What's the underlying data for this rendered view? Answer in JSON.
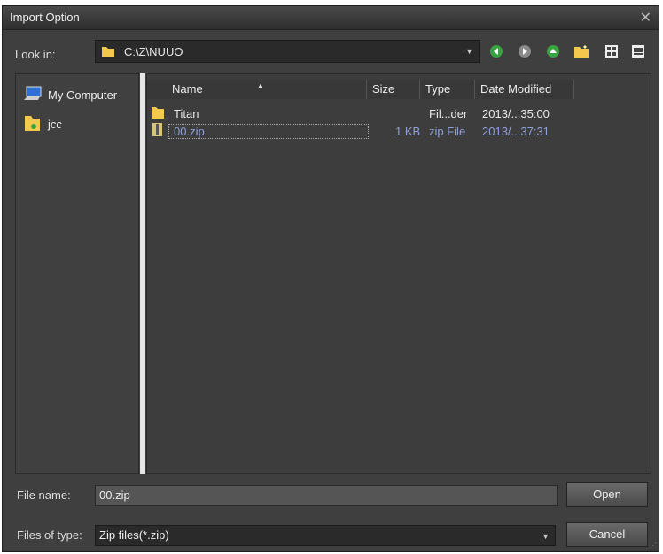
{
  "window": {
    "title": "Import Option",
    "close_glyph": "✕"
  },
  "look_in": {
    "label": "Look in:",
    "path": "C:\\Z\\NUUO"
  },
  "toolbar": {
    "icons": [
      "back-icon",
      "forward-icon",
      "up-icon",
      "new-folder-icon",
      "list-view-icon",
      "detail-view-icon"
    ]
  },
  "sidebar": {
    "items": [
      {
        "label": "My Computer",
        "icon": "computer-icon"
      },
      {
        "label": "jcc",
        "icon": "user-folder-icon"
      }
    ]
  },
  "filelist": {
    "columns": [
      "Name",
      "Size",
      "Type",
      "Date Modified"
    ],
    "rows": [
      {
        "name": "Titan",
        "size": "",
        "type": "Fil...der",
        "date": "2013/...35:00",
        "icon": "folder-icon",
        "selected": false
      },
      {
        "name": "00.zip",
        "size": "1 KB",
        "type": "zip File",
        "date": "2013/...37:31",
        "icon": "zip-file-icon",
        "selected": true
      }
    ]
  },
  "file_name": {
    "label": "File name:",
    "value": "00.zip"
  },
  "files_of_type": {
    "label": "Files of type:",
    "value": "Zip files(*.zip)"
  },
  "buttons": {
    "open": "Open",
    "cancel": "Cancel"
  },
  "colors": {
    "background": "#3f3f3f",
    "accent_text": "#8fa0d8",
    "folder": "#f2c94c"
  }
}
